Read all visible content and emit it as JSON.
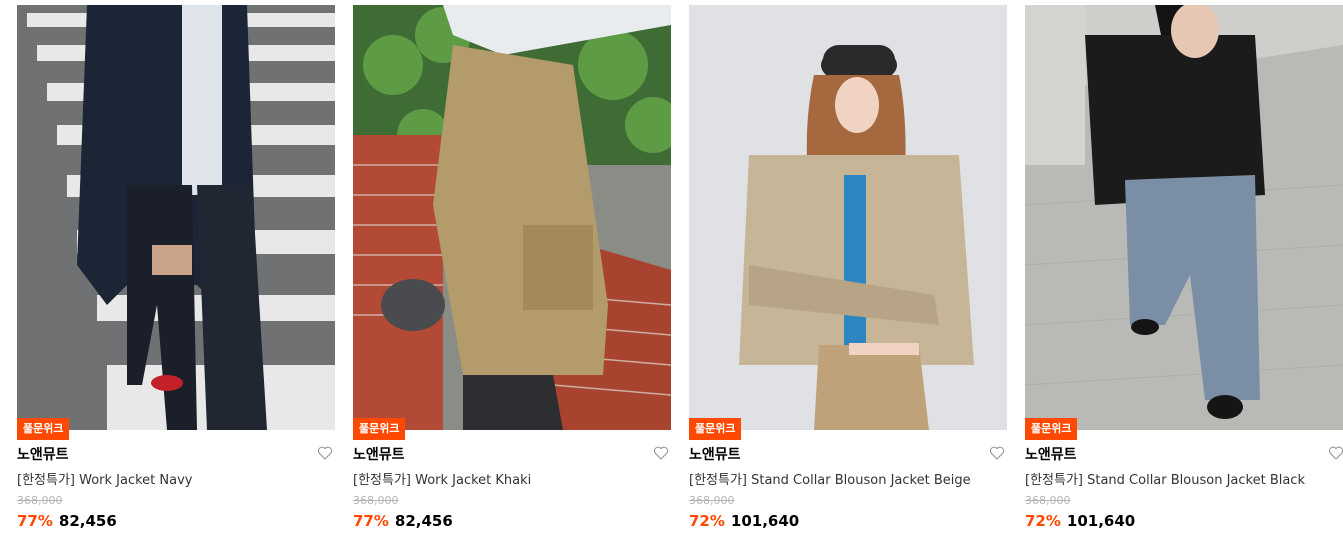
{
  "colors": {
    "accent": "#ff4800",
    "original_price": "#b5b5b5"
  },
  "products": [
    {
      "badge": "풀문위크",
      "brand": "노앤뮤트",
      "name": "[한정특가] Work Jacket Navy",
      "original_price": "368,000",
      "discount": "77%",
      "price": "82,456",
      "wishlist_icon": "heart-outline-icon"
    },
    {
      "badge": "풀문위크",
      "brand": "노앤뮤트",
      "name": "[한정특가] Work Jacket Khaki",
      "original_price": "368,000",
      "discount": "77%",
      "price": "82,456",
      "wishlist_icon": "heart-outline-icon"
    },
    {
      "badge": "풀문위크",
      "brand": "노앤뮤트",
      "name": "[한정특가] Stand Collar Blouson Jacket Beige",
      "original_price": "368,000",
      "discount": "72%",
      "price": "101,640",
      "wishlist_icon": "heart-outline-icon"
    },
    {
      "badge": "풀문위크",
      "brand": "노앤뮤트",
      "name": "[한정특가] Stand Collar Blouson Jacket Black",
      "original_price": "368,000",
      "discount": "72%",
      "price": "101,640",
      "wishlist_icon": "heart-outline-icon"
    }
  ]
}
